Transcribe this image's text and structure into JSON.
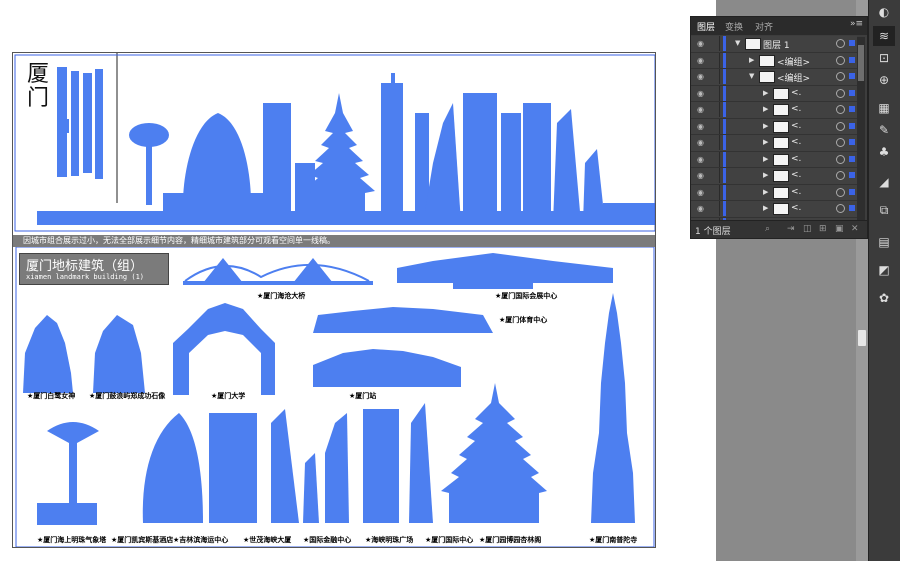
{
  "artboard": {
    "city_title": "厦门",
    "seal_text": "门",
    "note_bar": "因城市组合展示过小，无法全部展示细节内容，精细城市建筑部分可观看空间单一线稿。",
    "title_main": "厦门地标建筑（组）",
    "title_sub": "xiamen landmark building (1)",
    "captions": {
      "bridge": "厦门海沧大桥",
      "convention": "厦门国际会展中心",
      "sports": "厦门体育中心",
      "egret": "厦门白鹭女神",
      "zheng": "厦门鼓浪屿郑成功石像",
      "university": "厦门大学",
      "station": "厦门站",
      "lighthouse": "厦门海上明珠气象塔",
      "hotel": "厦门凯宾斯基酒店",
      "cruise": "吉林滨海运中心",
      "trade": "世茂海峡大厦",
      "finance": "国际金融中心",
      "plaza": "海峡明珠广场",
      "intl": "厦门国际中心",
      "garden": "厦门园博园杏林阁",
      "nanputuo": "厦门南普陀寺"
    },
    "star": "★"
  },
  "layers_panel": {
    "tabs": [
      "图层",
      "变换",
      "对齐"
    ],
    "menu_icon": "»≡",
    "rows": [
      {
        "name": "图层 1",
        "level": 0,
        "expanded": true
      },
      {
        "name": "<编组>",
        "level": 1,
        "expanded": false
      },
      {
        "name": "<编组>",
        "level": 1,
        "expanded": true
      },
      {
        "name": "<.",
        "level": 2,
        "expanded": false
      },
      {
        "name": "<.",
        "level": 2,
        "expanded": false
      },
      {
        "name": "<.",
        "level": 2,
        "expanded": false
      },
      {
        "name": "<.",
        "level": 2,
        "expanded": false
      },
      {
        "name": "<.",
        "level": 2,
        "expanded": false
      },
      {
        "name": "<.",
        "level": 2,
        "expanded": false
      },
      {
        "name": "<.",
        "level": 2,
        "expanded": false
      },
      {
        "name": "<.",
        "level": 2,
        "expanded": false
      },
      {
        "name": "<.",
        "level": 2,
        "expanded": false
      }
    ],
    "layer_count": "1 个图层",
    "accent_color": "#3b63e6"
  },
  "colors": {
    "silhouette": "#4d7ff0",
    "selection": "#3b63e6",
    "pasteboard": "#8a8a8a"
  }
}
